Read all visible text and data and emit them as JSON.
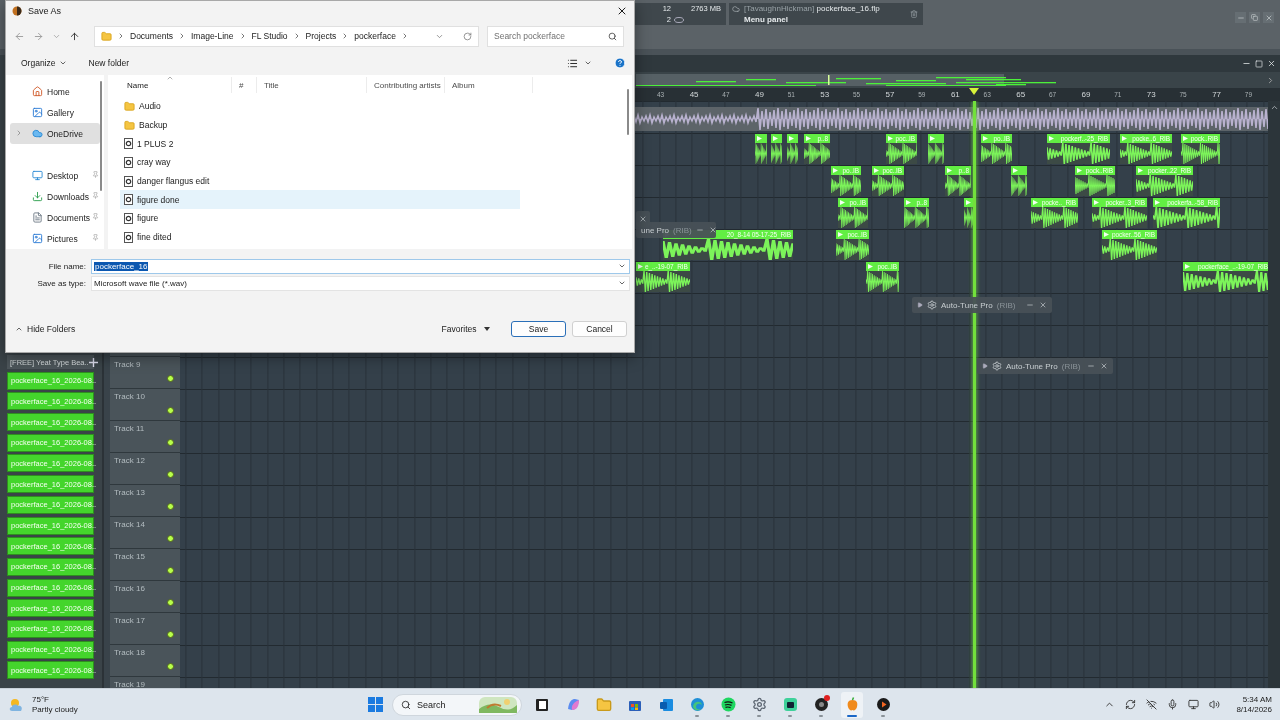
{
  "fl_studio": {
    "readouts": [
      "12",
      "2763 MB",
      "2"
    ],
    "hint_panel": {
      "owner": "[TavaughnHickman]",
      "file": "pockerface_16.flp",
      "hint": "Menu panel"
    },
    "browser": {
      "header": "[FREE] Yeat Type Bea..",
      "items": [
        "pockerface_16_2026-08..",
        "pockerface_16_2026-08..",
        "pockerface_16_2026-08..",
        "pockerface_16_2026-08..",
        "pockerface_16_2026-08..",
        "pockerface_16_2026-08..",
        "pockerface_16_2026-08..",
        "pockerface_16_2026-08..",
        "pockerface_16_2026-08..",
        "pockerface_16_2026-08..",
        "pockerface_16_2026-08..",
        "pockerface_16_2026-08..",
        "pockerface_16_2026-08..",
        "pockerface_16_2026-08..",
        "pockerface_16_2026-08.."
      ]
    },
    "playlist": {
      "ruler": [
        "43",
        "45",
        "47",
        "49",
        "51",
        "53",
        "55",
        "57",
        "59",
        "61",
        "63",
        "65",
        "67",
        "69",
        "71",
        "73",
        "75",
        "77",
        "79"
      ],
      "tracks": [
        "Track 9",
        "Track 10",
        "Track 11",
        "Track 12",
        "Track 13",
        "Track 14",
        "Track 15",
        "Track 16",
        "Track 17",
        "Track 18",
        "Track 19"
      ],
      "clip_rows": [
        [
          {},
          {},
          {},
          {
            "label": "p..8"
          },
          {
            "label": "poc..IB"
          },
          {},
          {
            "label": "po..IB"
          },
          {
            "label": "pockerf..-25_RIB"
          },
          {
            "label": "pocke..6_RIB"
          },
          {
            "label": "pock..RIB"
          }
        ],
        [
          {
            "label": "po..IB"
          },
          {
            "label": "poc..IB"
          },
          {
            "label": "p..8"
          },
          {},
          {
            "label": "pock..RIB"
          },
          {
            "label": "pocker..22_RIB"
          }
        ],
        [
          {
            "label": "po..IB"
          },
          {
            "label": "p..8"
          },
          {},
          {
            "label": "pocke.._RIB"
          },
          {
            "label": "pocker..3_RIB"
          },
          {
            "label": "pockerfa..-58_RIB"
          }
        ],
        [
          {
            "label": "20_8-14 05-17-25_RIB"
          },
          {
            "label": "poc..IB"
          },
          {
            "label": "pocker..56_RIB"
          }
        ],
        [
          {
            "label": "e_..-19-07_RIB"
          },
          {
            "label": "poc..IB"
          },
          {
            "label": "pockerface_..-19-07_RIB"
          }
        ]
      ],
      "plugin_windows": [
        {
          "name": "Auto-Tune Pro",
          "tag": "(RIB)"
        },
        {
          "name": "Auto-Tune Pro",
          "tag": "(RIB)"
        },
        {
          "name": "une Pro",
          "tag": "(RIB)"
        }
      ]
    }
  },
  "dialog": {
    "title": "Save As",
    "breadcrumb": [
      "Documents",
      "Image-Line",
      "FL Studio",
      "Projects",
      "pockerface"
    ],
    "search": {
      "placeholder": "Search pockerface"
    },
    "toolbar": {
      "organize": "Organize",
      "new_folder": "New folder"
    },
    "nav_top": [
      {
        "label": "Home",
        "selected": false,
        "expandable": false
      },
      {
        "label": "Gallery",
        "selected": false,
        "expandable": false
      },
      {
        "label": "OneDrive",
        "selected": true,
        "expandable": true
      }
    ],
    "nav_pinned": [
      {
        "label": "Desktop",
        "kind": "desktop"
      },
      {
        "label": "Downloads",
        "kind": "downloads"
      },
      {
        "label": "Documents",
        "kind": "documents"
      },
      {
        "label": "Pictures",
        "kind": "pictures"
      }
    ],
    "columns": [
      {
        "label": "Name",
        "sorted": true
      },
      {
        "label": "#",
        "sorted": false
      },
      {
        "label": "Title",
        "sorted": false
      },
      {
        "label": "Contributing artists",
        "sorted": false
      },
      {
        "label": "Album",
        "sorted": false
      }
    ],
    "files": [
      {
        "name": "Audio",
        "kind": "folder",
        "hovered": false
      },
      {
        "name": "Backup",
        "kind": "folder",
        "hovered": false
      },
      {
        "name": "1 PLUS 2",
        "kind": "file",
        "hovered": false
      },
      {
        "name": "cray way",
        "kind": "file",
        "hovered": false
      },
      {
        "name": "danger flangus edit",
        "kind": "file",
        "hovered": false
      },
      {
        "name": "figure done",
        "kind": "file",
        "hovered": true
      },
      {
        "name": "figure",
        "kind": "file",
        "hovered": false
      },
      {
        "name": "fine dited",
        "kind": "file",
        "hovered": false
      }
    ],
    "file_name": {
      "label": "File name:",
      "value": "pockerface_16",
      "text_selected": true
    },
    "save_type": {
      "label": "Save as type:",
      "value": "Microsoft wave file (*.wav)"
    },
    "hide_folders": "Hide Folders",
    "buttons": [
      {
        "label": "Favorites",
        "kind": "menu"
      },
      {
        "label": "Save",
        "kind": "default"
      },
      {
        "label": "Cancel",
        "kind": "plain"
      }
    ]
  },
  "taskbar": {
    "weather": {
      "temp": "75°F",
      "condition": "Partly cloudy"
    },
    "search": {
      "placeholder": "Search"
    },
    "apps": [
      {
        "kind": "task-view",
        "running": false,
        "selected": false,
        "alert": false
      },
      {
        "kind": "copilot",
        "running": false,
        "selected": false,
        "alert": false
      },
      {
        "kind": "folder",
        "running": false,
        "selected": false,
        "alert": false
      },
      {
        "kind": "store",
        "running": false,
        "selected": false,
        "alert": false
      },
      {
        "kind": "mail",
        "running": false,
        "selected": false,
        "alert": false
      },
      {
        "kind": "browser",
        "running": true,
        "selected": false,
        "alert": false
      },
      {
        "kind": "music",
        "running": true,
        "selected": false,
        "alert": false
      },
      {
        "kind": "settings",
        "running": true,
        "selected": false,
        "alert": false
      },
      {
        "kind": "app",
        "running": true,
        "selected": false,
        "alert": false
      },
      {
        "kind": "media",
        "running": true,
        "selected": false,
        "alert": true
      },
      {
        "kind": "daw",
        "running": true,
        "selected": true,
        "alert": false
      },
      {
        "kind": "player",
        "running": true,
        "selected": false,
        "alert": false
      }
    ],
    "clock": {
      "time": "5:34 AM",
      "date": "8/14/2026"
    }
  }
}
